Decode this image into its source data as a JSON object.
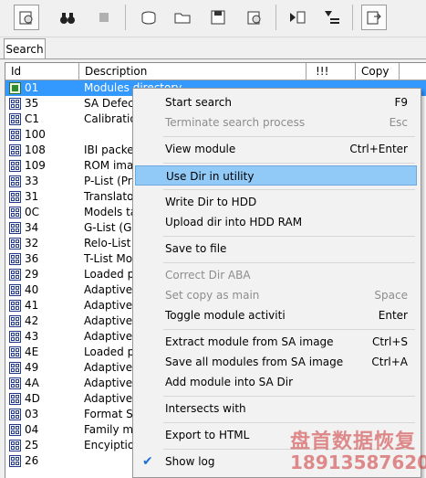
{
  "toolbar": {
    "buttons": [
      "settings-icon",
      "binoculars-icon",
      "stop-icon",
      "disk-icon",
      "open-folder-icon",
      "save-icon",
      "gear-disk-icon",
      "run-icon",
      "sort-icon",
      "export-icon"
    ]
  },
  "tabs": {
    "search": "Search"
  },
  "table": {
    "headers": {
      "id": "Id",
      "description": "Description",
      "flags": "!!!",
      "copy": "Copy"
    },
    "rows": [
      {
        "id": "01",
        "desc": "Modules directory"
      },
      {
        "id": "35",
        "desc": "SA Defects"
      },
      {
        "id": "C1",
        "desc": "Calibration"
      },
      {
        "id": "100",
        "desc": ""
      },
      {
        "id": "108",
        "desc": "IBI packet"
      },
      {
        "id": "109",
        "desc": "ROM imag"
      },
      {
        "id": "33",
        "desc": "P-List (Prin"
      },
      {
        "id": "31",
        "desc": "Translator"
      },
      {
        "id": "0C",
        "desc": "Models ta"
      },
      {
        "id": "34",
        "desc": "G-List (Gro"
      },
      {
        "id": "32",
        "desc": "Relo-List ("
      },
      {
        "id": "36",
        "desc": "T-List Mod"
      },
      {
        "id": "29",
        "desc": "Loaded pa"
      },
      {
        "id": "40",
        "desc": "Adaptive c"
      },
      {
        "id": "41",
        "desc": "Adaptive c"
      },
      {
        "id": "42",
        "desc": "Adaptive c"
      },
      {
        "id": "43",
        "desc": "Adaptive c"
      },
      {
        "id": "4E",
        "desc": "Loaded pa"
      },
      {
        "id": "49",
        "desc": "Adaptive c"
      },
      {
        "id": "4A",
        "desc": "Adaptive c"
      },
      {
        "id": "4D",
        "desc": "Adaptive c"
      },
      {
        "id": "03",
        "desc": "Format Se"
      },
      {
        "id": "04",
        "desc": "Family mo"
      },
      {
        "id": "25",
        "desc": "Encyiption"
      },
      {
        "id": "26",
        "desc": ""
      }
    ]
  },
  "menu": {
    "start_search": "Start search",
    "start_search_key": "F9",
    "terminate": "Terminate search process",
    "terminate_key": "Esc",
    "view_module": "View module",
    "view_module_key": "Ctrl+Enter",
    "use_dir": "Use Dir in utility",
    "write_dir": "Write Dir to HDD",
    "upload_dir": "Upload dir into HDD RAM",
    "save_file": "Save to file",
    "correct_dir": "Correct Dir ABA",
    "set_copy": "Set copy as main",
    "set_copy_key": "Space",
    "toggle": "Toggle module activiti",
    "toggle_key": "Enter",
    "extract": "Extract module from SA image",
    "extract_key": "Ctrl+S",
    "save_all": "Save all modules from SA image",
    "save_all_key": "Ctrl+A",
    "add_module": "Add module into SA Dir",
    "intersects": "Intersects with",
    "export_html": "Export to HTML",
    "show_log": "Show log"
  },
  "watermark": {
    "line1": "盘首数据恢复",
    "line2": "18913587620"
  }
}
